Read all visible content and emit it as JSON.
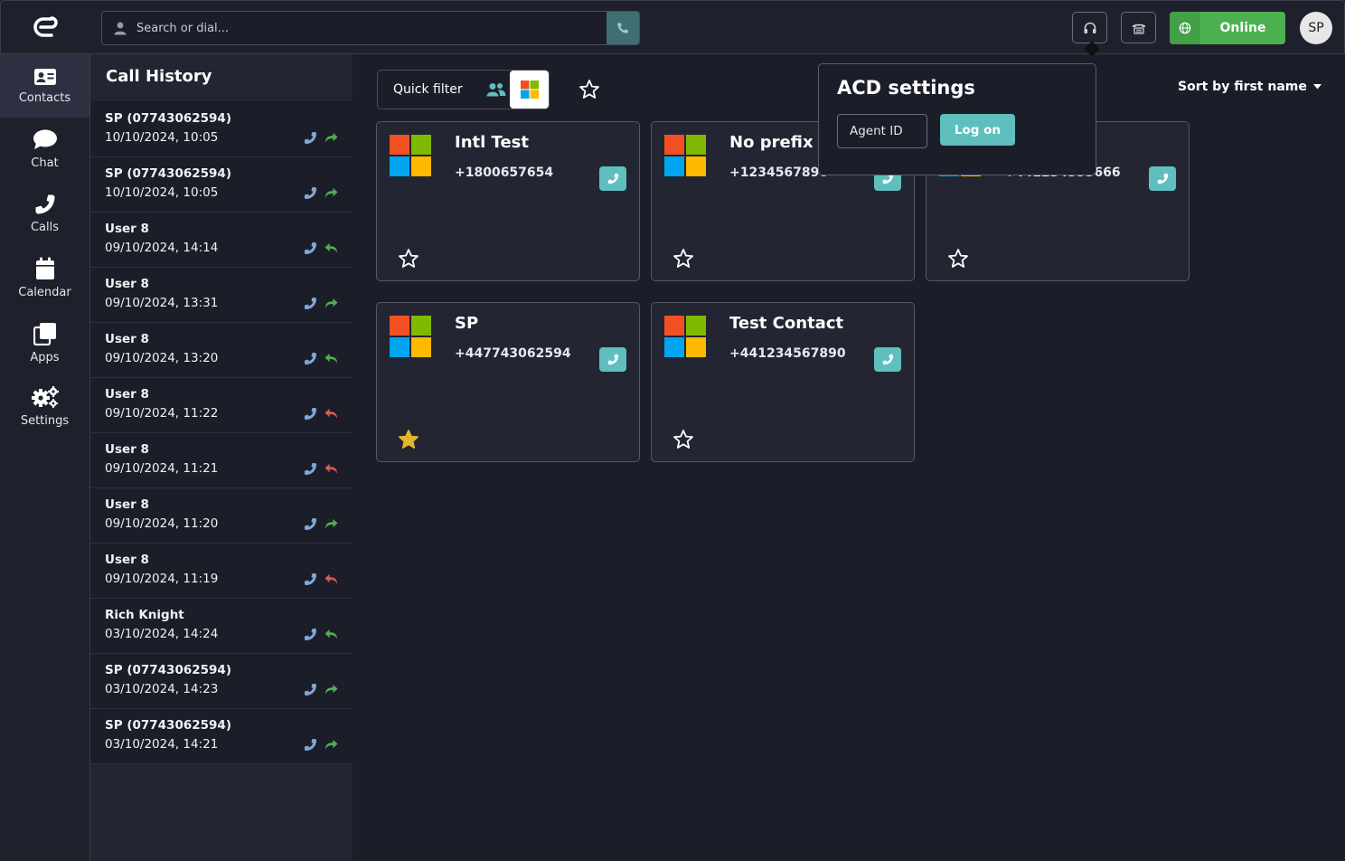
{
  "search": {
    "placeholder": "Search or dial..."
  },
  "status": {
    "label": "Online"
  },
  "avatar": {
    "initials": "SP"
  },
  "nav": [
    {
      "label": "Contacts",
      "icon": "contacts-icon",
      "active": true
    },
    {
      "label": "Chat",
      "icon": "chat-icon"
    },
    {
      "label": "Calls",
      "icon": "phone-icon"
    },
    {
      "label": "Calendar",
      "icon": "calendar-icon"
    },
    {
      "label": "Apps",
      "icon": "apps-icon"
    },
    {
      "label": "Settings",
      "icon": "gears-icon"
    }
  ],
  "history": {
    "title": "Call History",
    "rows": [
      {
        "name": "SP (07743062594)",
        "time": "10/10/2024, 10:05",
        "direction": "outgoing"
      },
      {
        "name": "SP (07743062594)",
        "time": "10/10/2024, 10:05",
        "direction": "outgoing"
      },
      {
        "name": "User 8",
        "time": "09/10/2024, 14:14",
        "direction": "incoming"
      },
      {
        "name": "User 8",
        "time": "09/10/2024, 13:31",
        "direction": "outgoing"
      },
      {
        "name": "User 8",
        "time": "09/10/2024, 13:20",
        "direction": "incoming"
      },
      {
        "name": "User 8",
        "time": "09/10/2024, 11:22",
        "direction": "missed"
      },
      {
        "name": "User 8",
        "time": "09/10/2024, 11:21",
        "direction": "missed"
      },
      {
        "name": "User 8",
        "time": "09/10/2024, 11:20",
        "direction": "outgoing"
      },
      {
        "name": "User 8",
        "time": "09/10/2024, 11:19",
        "direction": "missed"
      },
      {
        "name": "Rich Knight",
        "time": "03/10/2024, 14:24",
        "direction": "incoming"
      },
      {
        "name": "SP (07743062594)",
        "time": "03/10/2024, 14:23",
        "direction": "outgoing"
      },
      {
        "name": "SP (07743062594)",
        "time": "03/10/2024, 14:21",
        "direction": "outgoing"
      }
    ]
  },
  "filter": {
    "label": "Quick filter"
  },
  "sort": {
    "label": "Sort by first name"
  },
  "contacts": [
    {
      "name": "Intl Test",
      "number": "+1800657654",
      "favorite": false
    },
    {
      "name": "No prefix",
      "number": "+1234567890",
      "favorite": false
    },
    {
      "name": "",
      "number": "+441234555666",
      "favorite": false
    },
    {
      "name": "SP",
      "number": "+447743062594",
      "favorite": true
    },
    {
      "name": "Test Contact",
      "number": "+441234567890",
      "favorite": false
    }
  ],
  "acd": {
    "title": "ACD settings",
    "agent_placeholder": "Agent ID",
    "logon_label": "Log on"
  },
  "colors": {
    "accent": "#5fbfbf",
    "online": "#4cb050",
    "missed": "#e05555",
    "outgoing": "#4cb050",
    "phone": "#7fa8d8"
  }
}
